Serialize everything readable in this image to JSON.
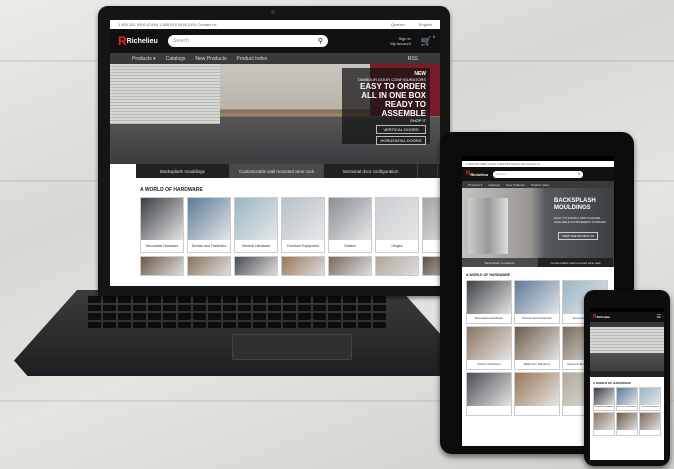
{
  "laptop": {
    "topbar": {
      "phone": "1 800 361 6000 (CAN)  1 800 619 5446 (US)  Contact us",
      "province": "Quebec",
      "language": "English"
    },
    "logo": "Richelieu",
    "search_placeholder": "Search",
    "account": {
      "signin": "Sign in",
      "my_account": "My account"
    },
    "cart_count": "0",
    "nav": {
      "products": "Products ▾",
      "catalogs": "Catalogs",
      "new_products": "New Products",
      "product_index": "Product Index",
      "rss": "RSS"
    },
    "hero": {
      "new": "NEW",
      "subtitle": "TAMBOUR DOOR CONFIGURATORS",
      "line1": "EASY TO ORDER",
      "line2": "ALL IN ONE BOX",
      "line3": "READY TO ASSEMBLE",
      "shop": "SHOP IT",
      "btn1": "VERTICAL DOORS",
      "btn2": "HORIZONTAL DOORS"
    },
    "tabs": [
      "Backsplash mouldings",
      "Customizable wall mounted wine rack",
      "Sectional door configuration",
      ""
    ],
    "section_title": "A WORLD OF HARDWARE",
    "cards": [
      {
        "label": "Decorative Hardware",
        "color": "#3b3f44"
      },
      {
        "label": "Screws and Fasteners",
        "color": "#5b7b9a"
      },
      {
        "label": "General Hardware",
        "color": "#9ab6c4"
      },
      {
        "label": "Furniture Equipment",
        "color": "#b8c0c8"
      },
      {
        "label": "Casters",
        "color": "#8a8f94"
      },
      {
        "label": "Hinges",
        "color": "#c9cdd1"
      },
      {
        "label": "S",
        "color": "#a3a6a9"
      }
    ],
    "row2_colors": [
      "#6b5a48",
      "#8a7560",
      "#4a4d52",
      "#9a7858",
      "#7a6b5c",
      "#b0a898",
      "#5a5048"
    ]
  },
  "tablet": {
    "topbar": "1 800 361 6000 (CAN)  1 800 619 5446 (US)  Contact us",
    "logo": "Richelieu",
    "search_placeholder": "Search",
    "nav": {
      "products": "Products ▾",
      "catalogs": "Catalogs",
      "new_products": "New Products",
      "product_index": "Product Index"
    },
    "hero": {
      "line1": "BACKSPLASH",
      "line2": "MOULDINGS",
      "sub": "EASY TO INSTALL AND CHANGE",
      "sub2": "AVAILABLE IN DIFFERENT FINISHES",
      "btn": "VIEW THE PRODUCTS"
    },
    "tabs": [
      "Backsplash mouldings",
      "Customizable wall mounted wine rack"
    ],
    "section_title": "A WORLD OF HARDWARE",
    "cards": [
      {
        "label": "Decorative Hardware",
        "color": "#3b3f44"
      },
      {
        "label": "Screws and Fasteners",
        "color": "#5b7b9a"
      },
      {
        "label": "General Hardware",
        "color": "#9ab6c4"
      },
      {
        "label": "Kitchen Solutions",
        "color": "#8a7560"
      },
      {
        "label": "Bathroom Solutions",
        "color": "#6b5a48"
      },
      {
        "label": "Closet & Storage Solutions",
        "color": "#7a6b5c"
      },
      {
        "label": "",
        "color": "#4a4d52"
      },
      {
        "label": "",
        "color": "#9a7858"
      },
      {
        "label": "",
        "color": "#b0a898"
      }
    ]
  },
  "phone": {
    "logo": "Richelieu",
    "section_title": "A WORLD OF HARDWARE",
    "cards": [
      {
        "label": "Decorative Hardware",
        "color": "#3b3f44"
      },
      {
        "label": "Screws and Fasteners",
        "color": "#5b7b9a"
      },
      {
        "label": "General Hardware",
        "color": "#9ab6c4"
      },
      {
        "label": "",
        "color": "#8a7560"
      },
      {
        "label": "",
        "color": "#6b5a48"
      },
      {
        "label": "",
        "color": "#7a6b5c"
      }
    ]
  }
}
